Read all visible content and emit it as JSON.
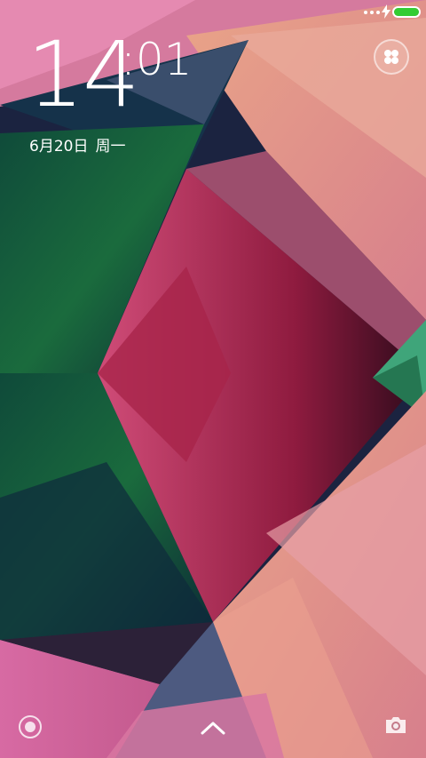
{
  "status_bar": {
    "signal_icon": "more-dots-icon",
    "charging_icon": "lightning-icon",
    "battery_level": 1.0,
    "battery_color": "#33cc33"
  },
  "lock_screen": {
    "time_hours": "14",
    "time_minutes": ":01",
    "date_day": "6月20日",
    "date_weekday": "周一",
    "widget_icon": "four-leaf-icon"
  },
  "bottom_bar": {
    "left_icon": "circle-target-icon",
    "center_icon": "chevron-up-icon",
    "right_icon": "camera-icon"
  },
  "colors": {
    "accent": "#ffffff",
    "battery": "#33cc33"
  }
}
